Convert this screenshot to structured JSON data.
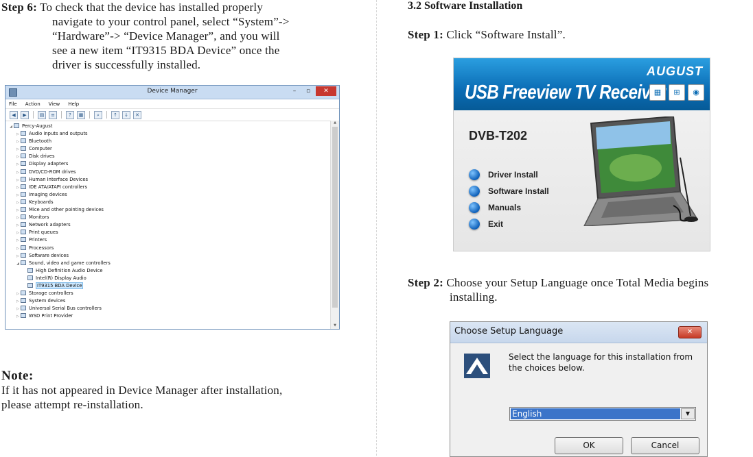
{
  "left": {
    "step6": {
      "label": "Step 6:",
      "line1": " To check that the device has installed properly",
      "line2": "navigate to your control panel, select “System”->",
      "line3": "“Hardware”-> “Device Manager”, and you will",
      "line4": "see a new item “IT9315 BDA Device” once the",
      "line5": "driver is successfully installed."
    },
    "device_manager": {
      "title": "Device Manager",
      "menu": [
        "File",
        "Action",
        "View",
        "Help"
      ],
      "nodes": [
        {
          "label": "Percy-August",
          "exp": "◢",
          "lvl": 0
        },
        {
          "label": "Audio inputs and outputs",
          "exp": "▷",
          "lvl": 1
        },
        {
          "label": "Bluetooth",
          "exp": "▷",
          "lvl": 1
        },
        {
          "label": "Computer",
          "exp": "▷",
          "lvl": 1
        },
        {
          "label": "Disk drives",
          "exp": "▷",
          "lvl": 1
        },
        {
          "label": "Display adapters",
          "exp": "▷",
          "lvl": 1
        },
        {
          "label": "DVD/CD-ROM drives",
          "exp": "▷",
          "lvl": 1
        },
        {
          "label": "Human Interface Devices",
          "exp": "▷",
          "lvl": 1
        },
        {
          "label": "IDE ATA/ATAPI controllers",
          "exp": "▷",
          "lvl": 1
        },
        {
          "label": "Imaging devices",
          "exp": "▷",
          "lvl": 1
        },
        {
          "label": "Keyboards",
          "exp": "▷",
          "lvl": 1
        },
        {
          "label": "Mice and other pointing devices",
          "exp": "▷",
          "lvl": 1
        },
        {
          "label": "Monitors",
          "exp": "▷",
          "lvl": 1
        },
        {
          "label": "Network adapters",
          "exp": "▷",
          "lvl": 1
        },
        {
          "label": "Print queues",
          "exp": "▷",
          "lvl": 1
        },
        {
          "label": "Printers",
          "exp": "▷",
          "lvl": 1
        },
        {
          "label": "Processors",
          "exp": "▷",
          "lvl": 1
        },
        {
          "label": "Software devices",
          "exp": "▷",
          "lvl": 1
        },
        {
          "label": "Sound, video and game controllers",
          "exp": "◢",
          "lvl": 1
        },
        {
          "label": "High Definition Audio Device",
          "exp": "",
          "lvl": 2
        },
        {
          "label": "Intel(R) Display Audio",
          "exp": "",
          "lvl": 2
        },
        {
          "label": "IT9315 BDA Device",
          "exp": "",
          "lvl": 2,
          "selected": true
        },
        {
          "label": "Storage controllers",
          "exp": "▷",
          "lvl": 1
        },
        {
          "label": "System devices",
          "exp": "▷",
          "lvl": 1
        },
        {
          "label": "Universal Serial Bus controllers",
          "exp": "▷",
          "lvl": 1
        },
        {
          "label": "WSD Print Provider",
          "exp": "▷",
          "lvl": 1
        }
      ]
    },
    "note": {
      "title": "Note:",
      "line1": "If it has not appeared in Device Manager after installation,",
      "line2": "please attempt re-installation."
    }
  },
  "right": {
    "section_title": "3.2 Software Installation",
    "step1": {
      "label": "Step 1:",
      "text": " Click “Software Install”."
    },
    "banner": {
      "brand": "AUGUST",
      "product": "USB Freeview TV Receiver",
      "model": "DVB-T202",
      "menu": [
        "Driver Install",
        "Software Install",
        "Manuals",
        "Exit"
      ]
    },
    "step2": {
      "label": "Step 2:",
      "line1": " Choose your Setup Language once Total Media begins",
      "line2": "installing."
    },
    "dialog": {
      "title": "Choose Setup Language",
      "message": "Select the language for this installation from the choices below.",
      "selected_language": "English",
      "ok_label": "OK",
      "cancel_label": "Cancel"
    }
  }
}
